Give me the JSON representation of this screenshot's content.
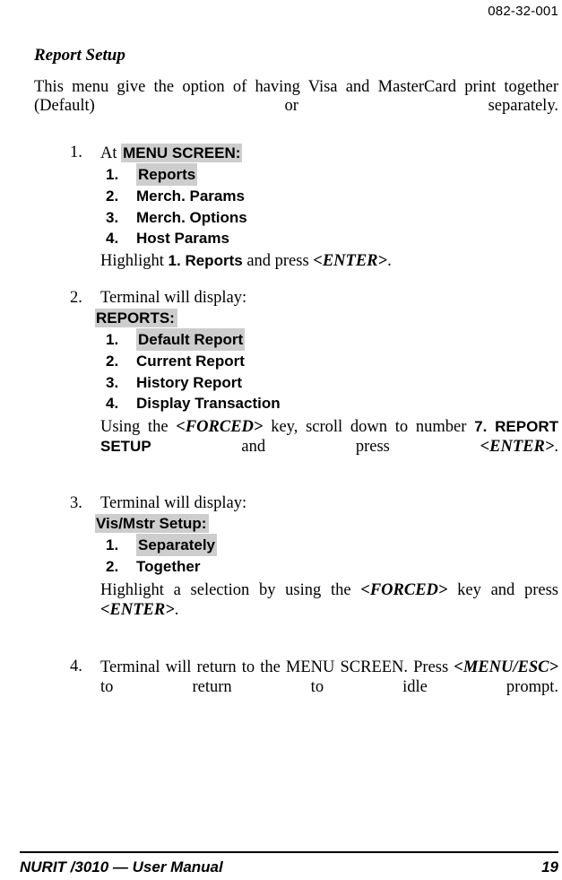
{
  "header": {
    "doc_number": "082-32-001"
  },
  "section": {
    "title": "Report Setup",
    "intro": "This menu give the option of having Visa and MasterCard print together (Default) or separately."
  },
  "steps": [
    {
      "number": "1.",
      "lead_prefix": "At",
      "screen_title": "MENU SCREEN:",
      "screen_title_highlighted": true,
      "menu_items": [
        {
          "num": "1.",
          "label": "Reports",
          "highlighted": true
        },
        {
          "num": "2.",
          "label": "Merch. Params",
          "highlighted": false
        },
        {
          "num": "3.",
          "label": "Merch. Options",
          "highlighted": false
        },
        {
          "num": "4.",
          "label": "Host Params",
          "highlighted": false
        }
      ],
      "instruction": {
        "part1": "Highlight ",
        "key1": "1. Reports",
        "part2": " and press ",
        "key2": "<ENTER>",
        "part3": "."
      }
    },
    {
      "number": "2.",
      "lead_prefix": "Terminal will display:",
      "screen_title": "REPORTS:",
      "screen_title_highlighted": true,
      "menu_items": [
        {
          "num": "1.",
          "label": "Default Report",
          "highlighted": true
        },
        {
          "num": "2.",
          "label": "Current Report",
          "highlighted": false
        },
        {
          "num": "3.",
          "label": "History Report",
          "highlighted": false
        },
        {
          "num": "4.",
          "label": "Display Transaction",
          "highlighted": false
        }
      ],
      "instruction": {
        "part1": "Using the ",
        "key1": "<FORCED>",
        "part2": " key, scroll down to number ",
        "key2": "7. REPORT SETUP",
        "part3": " and press ",
        "key3": "<ENTER>",
        "part4": "."
      }
    },
    {
      "number": "3.",
      "lead_prefix": "Terminal will display:",
      "screen_title": "Vis/Mstr Setup:",
      "screen_title_highlighted": true,
      "menu_items": [
        {
          "num": "1.",
          "label": "Separately",
          "highlighted": true
        },
        {
          "num": "2.",
          "label": "Together",
          "highlighted": false
        }
      ],
      "instruction": {
        "part1": "Highlight a selection by using the ",
        "key1": "<FORCED>",
        "part2": " key and press ",
        "key2": "<ENTER>",
        "part3": "."
      }
    },
    {
      "number": "4.",
      "instruction": {
        "part1": "Terminal will return to the MENU SCREEN.  Press ",
        "key1": "<MENU/ESC>",
        "part2": " to return to idle prompt."
      }
    }
  ],
  "footer": {
    "manual_title": "NURIT /3010 — User Manual",
    "page_number": "19"
  },
  "colors": {
    "highlight": "#cdcdcd",
    "text": "#000000",
    "background": "#ffffff"
  }
}
